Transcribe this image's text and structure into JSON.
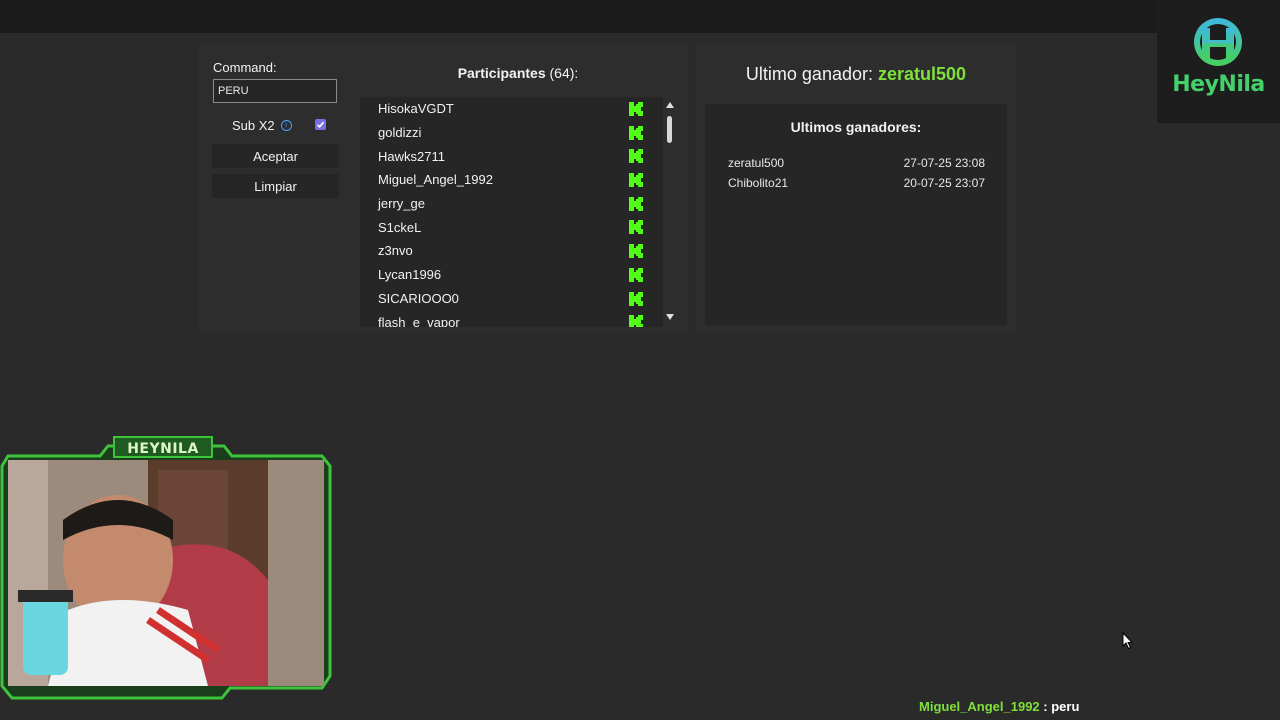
{
  "command": {
    "label": "Command:",
    "value": "PERU"
  },
  "options": {
    "sub_label": "Sub X2",
    "sub_checked": true
  },
  "buttons": {
    "accept": "Aceptar",
    "clear": "Limpiar"
  },
  "participants": {
    "title": "Participantes",
    "count": "(64):",
    "items": [
      "HisokaVGDT",
      "goldizzi",
      "Hawks2711",
      "Miguel_Angel_1992",
      "jerry_ge",
      "S1ckeL",
      "z3nvo",
      "Lycan1996",
      "SICARIOOO0",
      "flash_e_vapor"
    ],
    "platform_icon": "kick-icon",
    "icon_color": "#53fc18"
  },
  "winner": {
    "label": "Ultimo ganador:",
    "name": "zeratul500"
  },
  "recent_winners": {
    "title": "Ultimos ganadores:",
    "rows": [
      {
        "name": "zeratul500",
        "date": "27-07-25 23:08"
      },
      {
        "name": "Chibolito21",
        "date": "20-07-25 23:07"
      }
    ]
  },
  "logo": {
    "text": "HeyNila"
  },
  "webcam": {
    "label": "HEYNILA",
    "frame_color": "#3ec43a"
  },
  "chat": {
    "user": "Miguel_Angel_1992",
    "separator": " : ",
    "message": "peru"
  },
  "colors": {
    "accent_green": "#7ee03a",
    "background": "#2a2a2a",
    "panel": "#2d2d2d"
  }
}
